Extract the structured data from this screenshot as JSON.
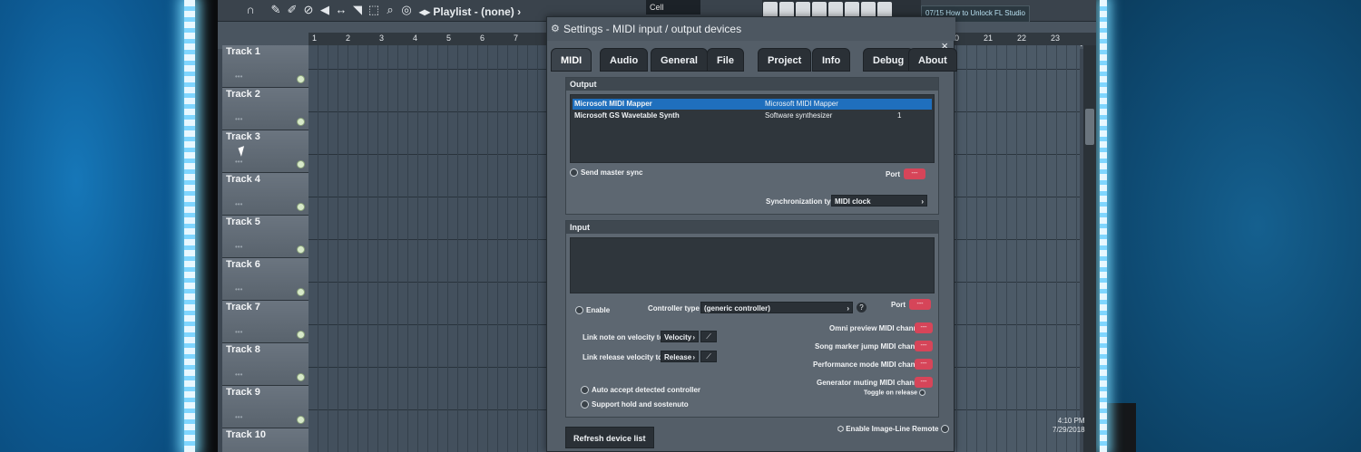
{
  "toolbar": {
    "playlist_title": "Playlist - (none)",
    "cell_label": "Cell",
    "news_text": "07/15 How to Unlock FL Studio"
  },
  "ruler": [
    "1",
    "2",
    "3",
    "4",
    "5",
    "6",
    "7",
    "8",
    "9",
    "10",
    "11",
    "12",
    "13",
    "14",
    "15",
    "16",
    "17",
    "18",
    "19",
    "20",
    "21",
    "22",
    "23"
  ],
  "tracks": [
    "Track 1",
    "Track 2",
    "Track 3",
    "Track 4",
    "Track 5",
    "Track 6",
    "Track 7",
    "Track 8",
    "Track 9",
    "Track 10"
  ],
  "dialog": {
    "title": "Settings - MIDI input / output devices",
    "close": "×",
    "tabs": [
      "MIDI",
      "Audio",
      "General",
      "File",
      "Project",
      "Info",
      "Debug",
      "About"
    ],
    "output": {
      "header": "Output",
      "devices": [
        {
          "name": "Microsoft MIDI Mapper",
          "type": "Microsoft MIDI Mapper",
          "port": "",
          "selected": true
        },
        {
          "name": "Microsoft GS Wavetable Synth",
          "type": "Software synthesizer",
          "port": "1",
          "selected": false
        }
      ],
      "send_master_sync": "Send master sync",
      "port_label": "Port",
      "port_value": "---",
      "sync_type_label": "Synchronization type",
      "sync_type_value": "MIDI clock"
    },
    "input": {
      "header": "Input",
      "enable": "Enable",
      "controller_type_label": "Controller type",
      "controller_type_value": "(generic controller)",
      "help": "?",
      "port_label": "Port",
      "port_value": "---",
      "link_note_label": "Link note on velocity to",
      "link_note_value": "Velocity",
      "link_release_label": "Link release velocity to",
      "link_release_value": "Release",
      "omni_preview": "Omni preview MIDI channel",
      "song_marker": "Song marker jump MIDI channel",
      "performance_mode": "Performance mode MIDI channel",
      "generator_muting": "Generator muting MIDI channel",
      "toggle_on_release": "Toggle on release",
      "auto_accept": "Auto accept detected controller",
      "support_hold": "Support hold and sostenuto",
      "image_line_remote": "Enable Image-Line Remote",
      "channel_value": "---"
    },
    "refresh_button": "Refresh device list"
  },
  "taskbar": {
    "time": "4:10 PM",
    "date": "7/29/2018"
  },
  "colors": {
    "accent_select": "#1f6fbd",
    "port_red": "#d64559",
    "led": "#7fd6ff"
  }
}
